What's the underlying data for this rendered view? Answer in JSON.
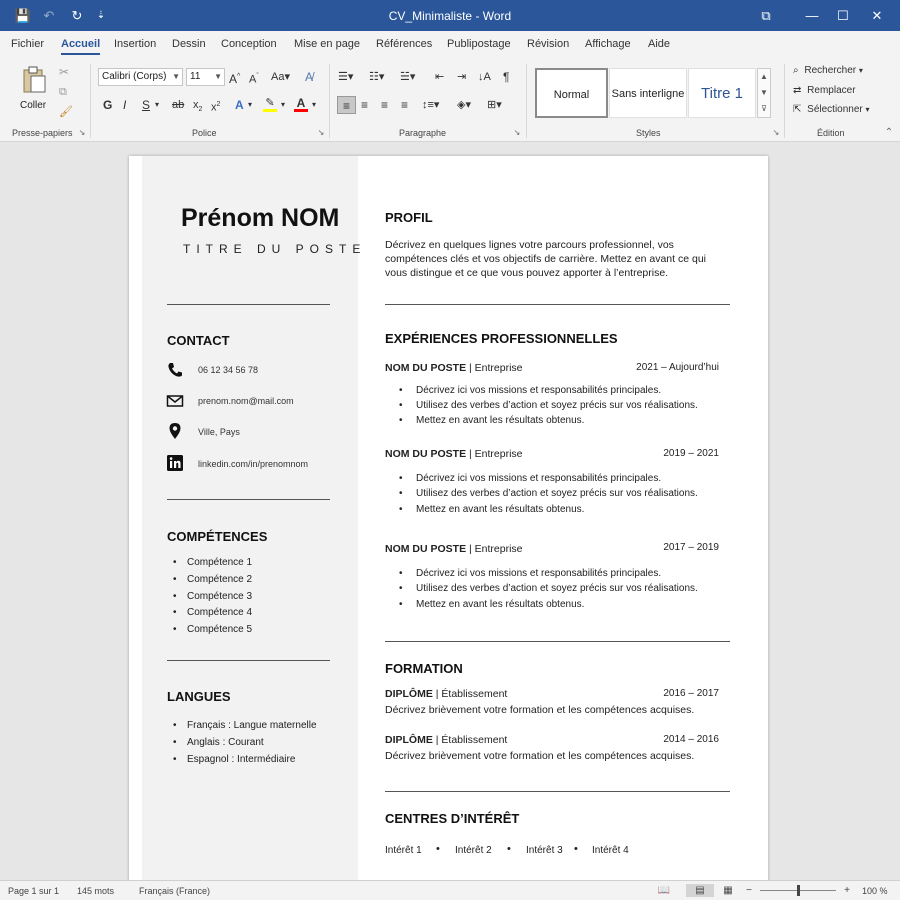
{
  "window": {
    "title": "CV_Minimaliste  -  Word",
    "qa_save": "💾",
    "qa_undo": "↶",
    "qa_redo": "↻",
    "qa_more": "⇣",
    "btn_ribbon": "⧉",
    "btn_minimize": "—",
    "btn_maximize": "☐",
    "btn_close": "✕"
  },
  "tabs": [
    "Fichier",
    "Accueil",
    "Insertion",
    "Dessin",
    "Conception",
    "Mise en page",
    "Références",
    "Publipostage",
    "Révision",
    "Affichage",
    "Aide"
  ],
  "ribbon": {
    "clipboard": {
      "paste_label": "Coller",
      "group_label": "Presse-papiers"
    },
    "font": {
      "name": "Calibri (Corps)",
      "size": "11",
      "group_label": "Police"
    },
    "paragraph": {
      "group_label": "Paragraphe"
    },
    "styles": {
      "items": [
        "Normal",
        "Sans interligne",
        "Titre 1"
      ],
      "group_label": "Styles"
    },
    "editing": {
      "find": "Rechercher",
      "replace": "Remplacer",
      "select": "Sélectionner",
      "group_label": "Édition"
    }
  },
  "resume": {
    "name": "Prénom NOM",
    "job_title": "TITRE DU POSTE",
    "contact": {
      "heading": "CONTACT",
      "phone": "06 12 34 56 78",
      "email": "prenom.nom@mail.com",
      "location": "Ville, Pays",
      "linkedin": "linkedin.com/in/prenomnom"
    },
    "skills": {
      "heading": "COMPÉTENCES",
      "items": [
        "Compétence 1",
        "Compétence 2",
        "Compétence 3",
        "Compétence 4",
        "Compétence 5"
      ]
    },
    "languages": {
      "heading": "LANGUES",
      "items": [
        "Français : Langue maternelle",
        "Anglais : Courant",
        "Espagnol : Intermédiaire"
      ]
    },
    "profile": {
      "heading": "PROFIL",
      "text": "Décrivez en quelques lignes votre parcours professionnel, vos compétences clés et vos objectifs de carrière. Mettez en avant ce qui vous distingue et ce que vous pouvez apporter à l’entreprise."
    },
    "experience": {
      "heading": "EXPÉRIENCES PROFESSIONNELLES",
      "jobs": [
        {
          "title": "NOM DU POSTE",
          "company": "Entreprise",
          "dates": "2021 – Aujourd’hui",
          "bullets": [
            "Décrivez ici vos missions et responsabilités principales.",
            "Utilisez des verbes d’action et soyez précis sur vos réalisations.",
            "Mettez en avant les résultats obtenus."
          ]
        },
        {
          "title": "NOM DU POSTE",
          "company": "Entreprise",
          "dates": "2019 – 2021",
          "bullets": [
            "Décrivez ici vos missions et responsabilités principales.",
            "Utilisez des verbes d’action et soyez précis sur vos réalisations.",
            "Mettez en avant les résultats obtenus."
          ]
        },
        {
          "title": "NOM DU POSTE",
          "company": "Entreprise",
          "dates": "2017 – 2019",
          "bullets": [
            "Décrivez ici vos missions et responsabilités principales.",
            "Utilisez des verbes d’action et soyez précis sur vos réalisations.",
            "Mettez en avant les résultats obtenus."
          ]
        }
      ]
    },
    "education": {
      "heading": "FORMATION",
      "items": [
        {
          "degree": "DIPLÔME",
          "school": "Établissement",
          "dates": "2016 – 2017",
          "desc": "Décrivez brièvement votre formation et les compétences acquises."
        },
        {
          "degree": "DIPLÔME",
          "school": "Établissement",
          "dates": "2014 – 2016",
          "desc": "Décrivez brièvement votre formation et les compétences acquises."
        }
      ]
    },
    "interests": {
      "heading": "CENTRES D’INTÉRÊT",
      "items": [
        "Intérêt 1",
        "Intérêt 2",
        "Intérêt 3",
        "Intérêt 4"
      ]
    }
  },
  "statusbar": {
    "page": "Page 1 sur 1",
    "words": "145 mots",
    "language": "Français (France)",
    "zoom_out": "−",
    "zoom_in": "+",
    "zoom": "100 %"
  },
  "colors": {
    "title_bar": "#2b579a",
    "ribbon": "#f3f3f3",
    "sidebar": "#f2f2f2",
    "highlight": "#ffff00",
    "font_color": "#ff0000"
  }
}
